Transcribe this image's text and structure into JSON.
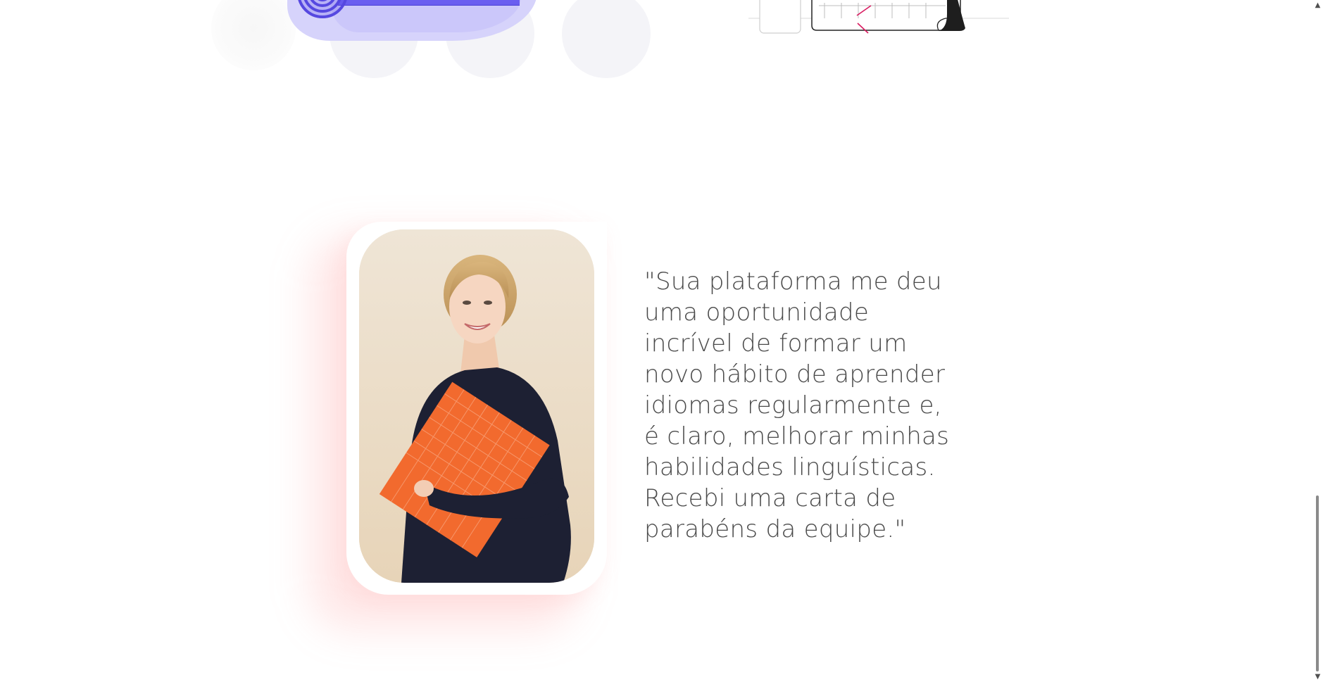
{
  "testimonial": {
    "quote_lines": [
      "\"Sua plataforma me deu",
      "uma oportunidade",
      "incrível de formar um",
      "novo hábito de aprender",
      "idiomas regularmente e,",
      "é claro, melhorar minhas",
      "habilidades linguísticas.",
      "Recebi uma carta de",
      "parabéns da equipe.\""
    ],
    "photo_icon": "woman-holding-orange-folder-photo"
  },
  "decorations": {
    "accent_purple": "#6a5ef0",
    "accent_lavender": "#d6d3fb",
    "shadow_pink": "#ffd9d9"
  },
  "scrollbar": {
    "up_icon": "chevron-up-icon",
    "down_icon": "chevron-down-icon",
    "up_glyph": "▲",
    "down_glyph": "▼"
  }
}
